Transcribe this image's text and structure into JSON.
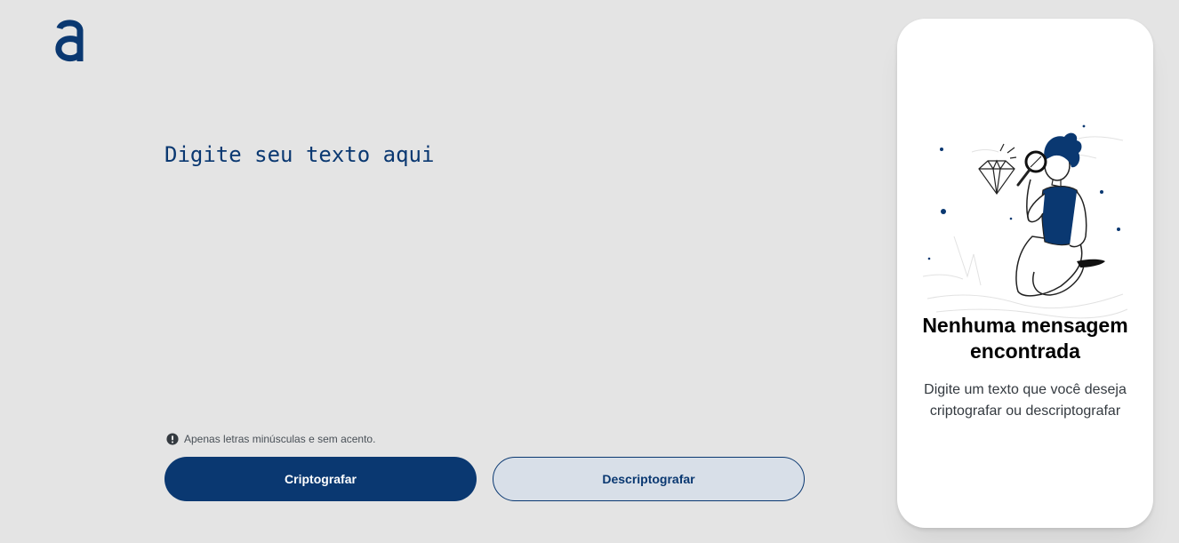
{
  "brand": {
    "logo_icon": "alura-a-logo-icon",
    "accent_color": "#0a3871"
  },
  "editor": {
    "placeholder": "Digite seu texto aqui",
    "value": ""
  },
  "hint": {
    "icon": "exclamation-circle-icon",
    "text": "Apenas letras minúsculas e sem acento."
  },
  "actions": {
    "encrypt_label": "Criptografar",
    "decrypt_label": "Descriptografar"
  },
  "output_panel": {
    "illustration": "person-with-magnifying-glass-illustration",
    "title": "Nenhuma mensagem encontrada",
    "description": "Digite um texto que você deseja criptografar ou descriptografar"
  }
}
